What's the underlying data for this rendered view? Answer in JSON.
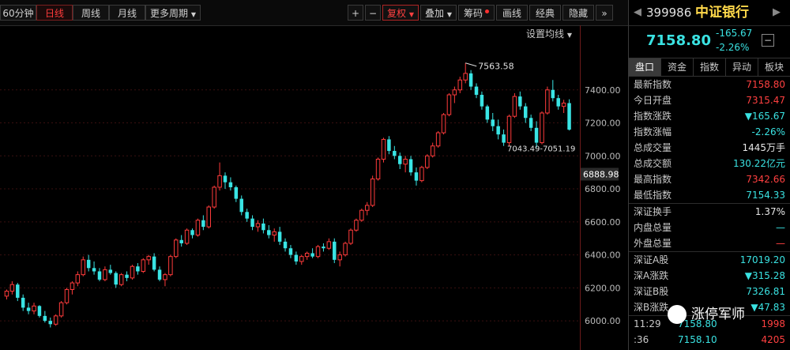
{
  "toolbar": {
    "periods": [
      "60分钟",
      "日线",
      "周线",
      "月线"
    ],
    "more_periods": "更多周期",
    "zoom_in": "+",
    "zoom_out": "−",
    "fuquan": "复权",
    "overlay": "叠加",
    "chips": "筹码",
    "draw": "画线",
    "classic": "经典",
    "hide": "隐藏",
    "arrows": "»"
  },
  "chart": {
    "ma_settings": "设置均线",
    "high_label": "7563.58",
    "low_label": "7043.49-7051.19",
    "current_price_tag": "6888.98",
    "y_ticks": [
      "7400.00",
      "7200.00",
      "7000.00",
      "6800.00",
      "6600.00",
      "6400.00",
      "6200.00",
      "6000.00"
    ]
  },
  "chart_data": {
    "type": "candlestick",
    "y_range": [
      5900,
      7600
    ],
    "up_color": "#ff3b3b",
    "down_color": "#39e4e4",
    "candles": [
      [
        6150,
        6190,
        6130,
        6180
      ],
      [
        6180,
        6240,
        6160,
        6220
      ],
      [
        6220,
        6230,
        6120,
        6140
      ],
      [
        6140,
        6160,
        6060,
        6080
      ],
      [
        6080,
        6110,
        6040,
        6060
      ],
      [
        6060,
        6110,
        6040,
        6090
      ],
      [
        6090,
        6095,
        6020,
        6030
      ],
      [
        6030,
        6060,
        5990,
        6000
      ],
      [
        6000,
        6020,
        5960,
        5980
      ],
      [
        5980,
        6040,
        5970,
        6030
      ],
      [
        6030,
        6120,
        6020,
        6110
      ],
      [
        6110,
        6200,
        6100,
        6190
      ],
      [
        6190,
        6240,
        6160,
        6230
      ],
      [
        6230,
        6300,
        6210,
        6280
      ],
      [
        6280,
        6390,
        6270,
        6370
      ],
      [
        6370,
        6400,
        6300,
        6320
      ],
      [
        6320,
        6360,
        6280,
        6300
      ],
      [
        6300,
        6320,
        6240,
        6250
      ],
      [
        6250,
        6330,
        6240,
        6310
      ],
      [
        6310,
        6340,
        6280,
        6290
      ],
      [
        6290,
        6300,
        6200,
        6220
      ],
      [
        6220,
        6290,
        6210,
        6280
      ],
      [
        6280,
        6300,
        6240,
        6260
      ],
      [
        6260,
        6340,
        6250,
        6330
      ],
      [
        6330,
        6350,
        6280,
        6300
      ],
      [
        6300,
        6380,
        6290,
        6370
      ],
      [
        6370,
        6400,
        6340,
        6390
      ],
      [
        6390,
        6410,
        6300,
        6310
      ],
      [
        6310,
        6330,
        6240,
        6250
      ],
      [
        6250,
        6290,
        6210,
        6280
      ],
      [
        6280,
        6400,
        6270,
        6390
      ],
      [
        6390,
        6500,
        6380,
        6490
      ],
      [
        6490,
        6520,
        6450,
        6470
      ],
      [
        6470,
        6560,
        6460,
        6550
      ],
      [
        6550,
        6560,
        6500,
        6520
      ],
      [
        6520,
        6620,
        6510,
        6610
      ],
      [
        6610,
        6640,
        6550,
        6570
      ],
      [
        6570,
        6700,
        6560,
        6690
      ],
      [
        6690,
        6820,
        6680,
        6810
      ],
      [
        6810,
        6960,
        6790,
        6880
      ],
      [
        6880,
        6900,
        6800,
        6840
      ],
      [
        6840,
        6870,
        6790,
        6810
      ],
      [
        6810,
        6820,
        6720,
        6740
      ],
      [
        6740,
        6760,
        6640,
        6660
      ],
      [
        6660,
        6680,
        6600,
        6620
      ],
      [
        6620,
        6640,
        6550,
        6570
      ],
      [
        6570,
        6610,
        6540,
        6590
      ],
      [
        6590,
        6620,
        6530,
        6550
      ],
      [
        6550,
        6580,
        6500,
        6520
      ],
      [
        6520,
        6560,
        6480,
        6540
      ],
      [
        6540,
        6570,
        6460,
        6480
      ],
      [
        6480,
        6500,
        6420,
        6440
      ],
      [
        6440,
        6460,
        6380,
        6400
      ],
      [
        6400,
        6420,
        6340,
        6360
      ],
      [
        6360,
        6400,
        6340,
        6390
      ],
      [
        6390,
        6420,
        6370,
        6410
      ],
      [
        6410,
        6440,
        6380,
        6390
      ],
      [
        6390,
        6460,
        6380,
        6450
      ],
      [
        6450,
        6470,
        6420,
        6440
      ],
      [
        6440,
        6500,
        6430,
        6480
      ],
      [
        6480,
        6500,
        6350,
        6370
      ],
      [
        6370,
        6420,
        6330,
        6400
      ],
      [
        6400,
        6480,
        6390,
        6470
      ],
      [
        6470,
        6560,
        6460,
        6550
      ],
      [
        6550,
        6620,
        6540,
        6610
      ],
      [
        6610,
        6680,
        6600,
        6670
      ],
      [
        6670,
        6720,
        6640,
        6700
      ],
      [
        6700,
        6880,
        6690,
        6860
      ],
      [
        6860,
        6990,
        6850,
        6980
      ],
      [
        6980,
        7110,
        6960,
        7100
      ],
      [
        7100,
        7120,
        7010,
        7030
      ],
      [
        7030,
        7060,
        6980,
        7000
      ],
      [
        7000,
        7020,
        6920,
        6950
      ],
      [
        6950,
        7000,
        6900,
        6980
      ],
      [
        6980,
        7000,
        6880,
        6900
      ],
      [
        6900,
        6930,
        6820,
        6850
      ],
      [
        6850,
        6940,
        6840,
        6930
      ],
      [
        6930,
        7010,
        6920,
        7000
      ],
      [
        7000,
        7080,
        6990,
        7060
      ],
      [
        7060,
        7150,
        7050,
        7140
      ],
      [
        7140,
        7260,
        7130,
        7250
      ],
      [
        7250,
        7380,
        7240,
        7370
      ],
      [
        7370,
        7420,
        7320,
        7400
      ],
      [
        7400,
        7480,
        7380,
        7460
      ],
      [
        7460,
        7563,
        7440,
        7500
      ],
      [
        7500,
        7520,
        7400,
        7420
      ],
      [
        7420,
        7440,
        7350,
        7370
      ],
      [
        7370,
        7390,
        7280,
        7300
      ],
      [
        7300,
        7310,
        7200,
        7220
      ],
      [
        7220,
        7260,
        7150,
        7180
      ],
      [
        7180,
        7220,
        7100,
        7130
      ],
      [
        7130,
        7160,
        7060,
        7080
      ],
      [
        7080,
        7250,
        7060,
        7240
      ],
      [
        7240,
        7380,
        7230,
        7360
      ],
      [
        7360,
        7390,
        7280,
        7300
      ],
      [
        7300,
        7320,
        7200,
        7230
      ],
      [
        7230,
        7250,
        7150,
        7170
      ],
      [
        7170,
        7210,
        7050,
        7080
      ],
      [
        7080,
        7270,
        7070,
        7260
      ],
      [
        7260,
        7420,
        7250,
        7400
      ],
      [
        7400,
        7460,
        7330,
        7350
      ],
      [
        7350,
        7370,
        7280,
        7300
      ],
      [
        7300,
        7340,
        7260,
        7320
      ],
      [
        7320,
        7343,
        7154,
        7159
      ]
    ],
    "high_point": 7563.58,
    "low_range": "7043.49-7051.19"
  },
  "sidebar": {
    "code": "399986",
    "name": "中证银行",
    "price": "7158.80",
    "change": "-165.67",
    "change_pct": "-2.26%",
    "tabs": [
      "盘口",
      "资金",
      "指数",
      "异动",
      "板块"
    ],
    "rows": [
      {
        "label": "最新指数",
        "value": "7158.80",
        "color": "red"
      },
      {
        "label": "今日开盘",
        "value": "7315.47",
        "color": "red"
      },
      {
        "label": "指数涨跌",
        "value": "▼165.67",
        "color": "green"
      },
      {
        "label": "指数涨幅",
        "value": "-2.26%",
        "color": "green"
      },
      {
        "label": "总成交量",
        "value": "1445万手",
        "color": "white"
      },
      {
        "label": "总成交额",
        "value": "130.22亿元",
        "color": "green"
      },
      {
        "label": "最高指数",
        "value": "7342.66",
        "color": "red"
      },
      {
        "label": "最低指数",
        "value": "7154.33",
        "color": "green"
      }
    ],
    "rows2": [
      {
        "label": "深证换手",
        "value": "1.37%",
        "color": "white"
      },
      {
        "label": "内盘总量",
        "value": "—",
        "color": "green"
      },
      {
        "label": "外盘总量",
        "value": "—",
        "color": "red"
      }
    ],
    "rows3": [
      {
        "label": "深证A股",
        "value": "17019.20",
        "color": "green"
      },
      {
        "label": "深A涨跌",
        "value": "▼315.28",
        "color": "green"
      },
      {
        "label": "深证B股",
        "value": "7326.81",
        "color": "green"
      },
      {
        "label": "深B涨跌",
        "value": "▼47.83",
        "color": "green"
      }
    ],
    "ticks": [
      {
        "time": "11:29",
        "price": "7158.80",
        "vol": "1998"
      },
      {
        "time": ":36",
        "price": "7158.10",
        "vol": "4205"
      }
    ]
  },
  "watermark": "涨停军师"
}
